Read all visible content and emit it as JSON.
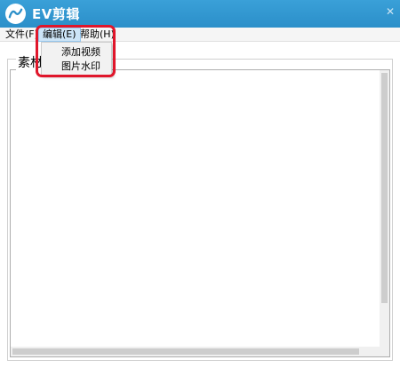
{
  "window": {
    "title": "EV剪辑",
    "logo_icon": "ev-logo-icon",
    "close_glyph": "✕"
  },
  "menubar": {
    "items": [
      {
        "label": "文件(F)"
      },
      {
        "label": "编辑(E)"
      },
      {
        "label": "帮助(H)"
      }
    ]
  },
  "edit_menu": {
    "items": [
      {
        "label": "添加视频"
      },
      {
        "label": "图片水印"
      }
    ]
  },
  "materials": {
    "group_label": "素材"
  },
  "colors": {
    "titlebar": "#2b8fc9",
    "highlight": "#e0162b"
  }
}
